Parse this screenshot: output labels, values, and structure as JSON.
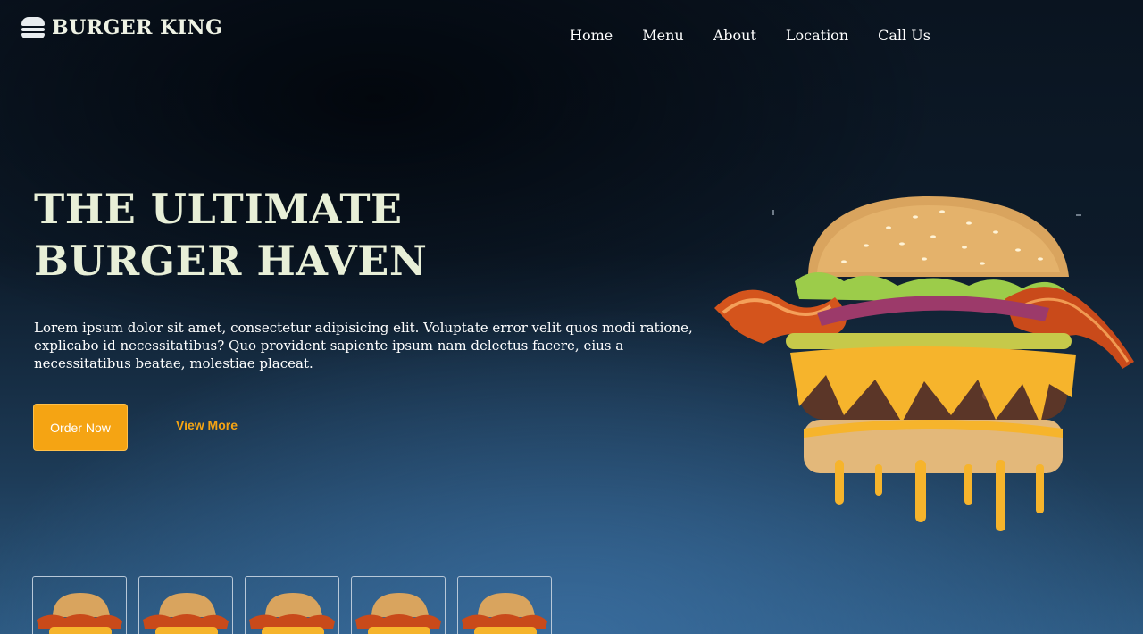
{
  "brand": {
    "name": "BURGER KING",
    "icon": "burger-icon"
  },
  "nav": {
    "items": [
      {
        "label": "Home"
      },
      {
        "label": "Menu"
      },
      {
        "label": "About"
      },
      {
        "label": "Location"
      },
      {
        "label": "Call Us"
      }
    ]
  },
  "hero": {
    "title_line1": "THE ULTIMATE",
    "title_line2": "BURGER HAVEN",
    "description": "Lorem ipsum dolor sit amet, consectetur adipisicing elit. Voluptate error velit quos modi ratione, explicabo id necessitatibus? Quo provident sapiente ipsum nam delectus facere, eius a necessitatibus beatae, molestiae placeat.",
    "primary_button": "Order Now",
    "secondary_button": "View More"
  },
  "thumbnails": {
    "count": 5,
    "icon": "burger-thumbnail"
  },
  "colors": {
    "accent": "#f5a413",
    "title": "#e8efd7",
    "background_dark": "#0a1420",
    "background_light": "#2d5a82"
  }
}
